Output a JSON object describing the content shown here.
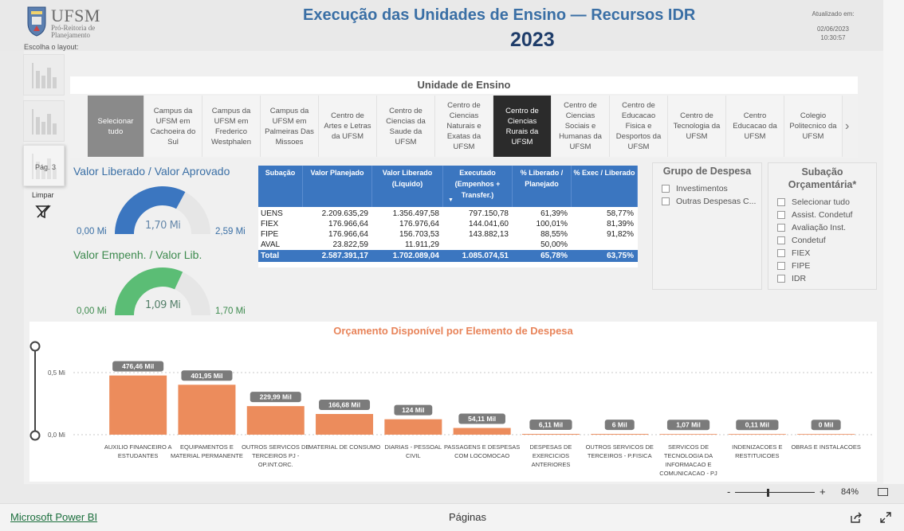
{
  "header": {
    "brand": "UFSM",
    "subbrand_line1": "Pró-Reitoria de",
    "subbrand_line2": "Planejamento",
    "choose_layout": "Escolha o layout:",
    "title": "Execução das Unidades de Ensino — Recursos IDR",
    "year": "2023",
    "updated_label": "Atualizado em:",
    "updated_date": "02/06/2023",
    "updated_time": "10:30:57"
  },
  "rail": {
    "page_label": "Pág. 3",
    "clear_label": "Limpar"
  },
  "unit_slicer": {
    "title": "Unidade de Ensino",
    "items": [
      {
        "label": "Selecionar tudo",
        "state": "all"
      },
      {
        "label": "Campus da UFSM em Cachoeira do Sul",
        "state": "normal"
      },
      {
        "label": "Campus da UFSM em Frederico Westphalen",
        "state": "normal"
      },
      {
        "label": "Campus da UFSM em Palmeiras Das Missoes",
        "state": "normal"
      },
      {
        "label": "Centro de Artes e Letras da UFSM",
        "state": "normal"
      },
      {
        "label": "Centro de Ciencias da Saude da UFSM",
        "state": "normal"
      },
      {
        "label": "Centro de Ciencias Naturais e Exatas da UFSM",
        "state": "normal"
      },
      {
        "label": "Centro de Ciencias Rurais da UFSM",
        "state": "selected"
      },
      {
        "label": "Centro de Ciencias Sociais e Humanas da UFSM",
        "state": "normal"
      },
      {
        "label": "Centro de Educacao Fisica e Desportos da UFSM",
        "state": "normal"
      },
      {
        "label": "Centro de Tecnologia da UFSM",
        "state": "normal"
      },
      {
        "label": "Centro Educacao da UFSM",
        "state": "normal"
      },
      {
        "label": "Colegio Politecnico da UFSM",
        "state": "normal"
      }
    ]
  },
  "gauge1": {
    "title": "Valor Liberado / Valor Aprovado",
    "min": "0,00 Mi",
    "max": "2,59 Mi",
    "value_label": "1,70 Mi",
    "fraction": 0.657,
    "color": "#3b76c0"
  },
  "gauge2": {
    "title": "Valor Empenh. / Valor Lib.",
    "min": "0,00 Mi",
    "max": "1,70 Mi",
    "value_label": "1,09 Mi",
    "fraction": 0.638,
    "color": "#5bbd75"
  },
  "table": {
    "headers": [
      "Subação",
      "Valor Planejado",
      "Valor Liberado (Líquido)",
      "Executado (Empenhos + Transfer.)",
      "% Liberado / Planejado",
      "% Exec / Liberado"
    ],
    "rows": [
      [
        "UENS",
        "2.209.635,29",
        "1.356.497,58",
        "797.150,78",
        "61,39%",
        "58,77%"
      ],
      [
        "FIEX",
        "176.966,64",
        "176.976,64",
        "144.041,60",
        "100,01%",
        "81,39%"
      ],
      [
        "FIPE",
        "176.966,64",
        "156.703,53",
        "143.882,13",
        "88,55%",
        "91,82%"
      ],
      [
        "AVAL",
        "23.822,59",
        "11.911,29",
        "",
        "50,00%",
        ""
      ]
    ],
    "total": [
      "Total",
      "2.587.391,17",
      "1.702.089,04",
      "1.085.074,51",
      "65,78%",
      "63,75%"
    ]
  },
  "grupo_slicer": {
    "title": "Grupo de Despesa",
    "options": [
      "Investimentos",
      "Outras Despesas C..."
    ]
  },
  "subacao_slicer": {
    "title_line1": "Subação",
    "title_line2": "Orçamentária*",
    "options": [
      "Selecionar tudo",
      "Assist. Condetuf",
      "Avaliação Inst.",
      "Condetuf",
      "FIEX",
      "FIPE",
      "IDR"
    ]
  },
  "chart_data": {
    "type": "bar",
    "title": "Orçamento Disponível por Elemento de Despesa",
    "categories": [
      "AUXILIO FINANCEIRO A ESTUDANTES",
      "EQUIPAMENTOS E MATERIAL PERMANENTE",
      "OUTROS SERVICOS DE TERCEIROS PJ - OP.INT.ORC.",
      "MATERIAL DE CONSUMO",
      "DIARIAS - PESSOAL CIVIL",
      "PASSAGENS E DESPESAS COM LOCOMOCAO",
      "DESPESAS DE EXERCICIOS ANTERIORES",
      "OUTROS SERVICOS DE TERCEIROS - P.FISICA",
      "SERVICOS DE TECNOLOGIA DA INFORMACAO E COMUNICACAO - PJ",
      "INDENIZACOES E RESTITUICOES",
      "OBRAS E INSTALACOES"
    ],
    "values": [
      476.46,
      401.95,
      229.99,
      166.68,
      124,
      54.11,
      6.11,
      6,
      1.07,
      0.11,
      0
    ],
    "value_labels": [
      "476,46 Mil",
      "401,95 Mil",
      "229,99 Mil",
      "166,68 Mil",
      "124 Mil",
      "54,11 Mil",
      "6,11 Mil",
      "6 Mil",
      "1,07 Mil",
      "0,11 Mil",
      "0 Mil"
    ],
    "ytick_labels": [
      "0,5 Mi",
      "0,0 Mi"
    ],
    "yticks": [
      500,
      0
    ],
    "ylim": [
      0,
      500
    ],
    "bar_color": "#ec8c5c",
    "grid": true
  },
  "footer": {
    "zoom": "84%",
    "brand_link": "Microsoft Power BI",
    "pages_label": "Páginas"
  }
}
